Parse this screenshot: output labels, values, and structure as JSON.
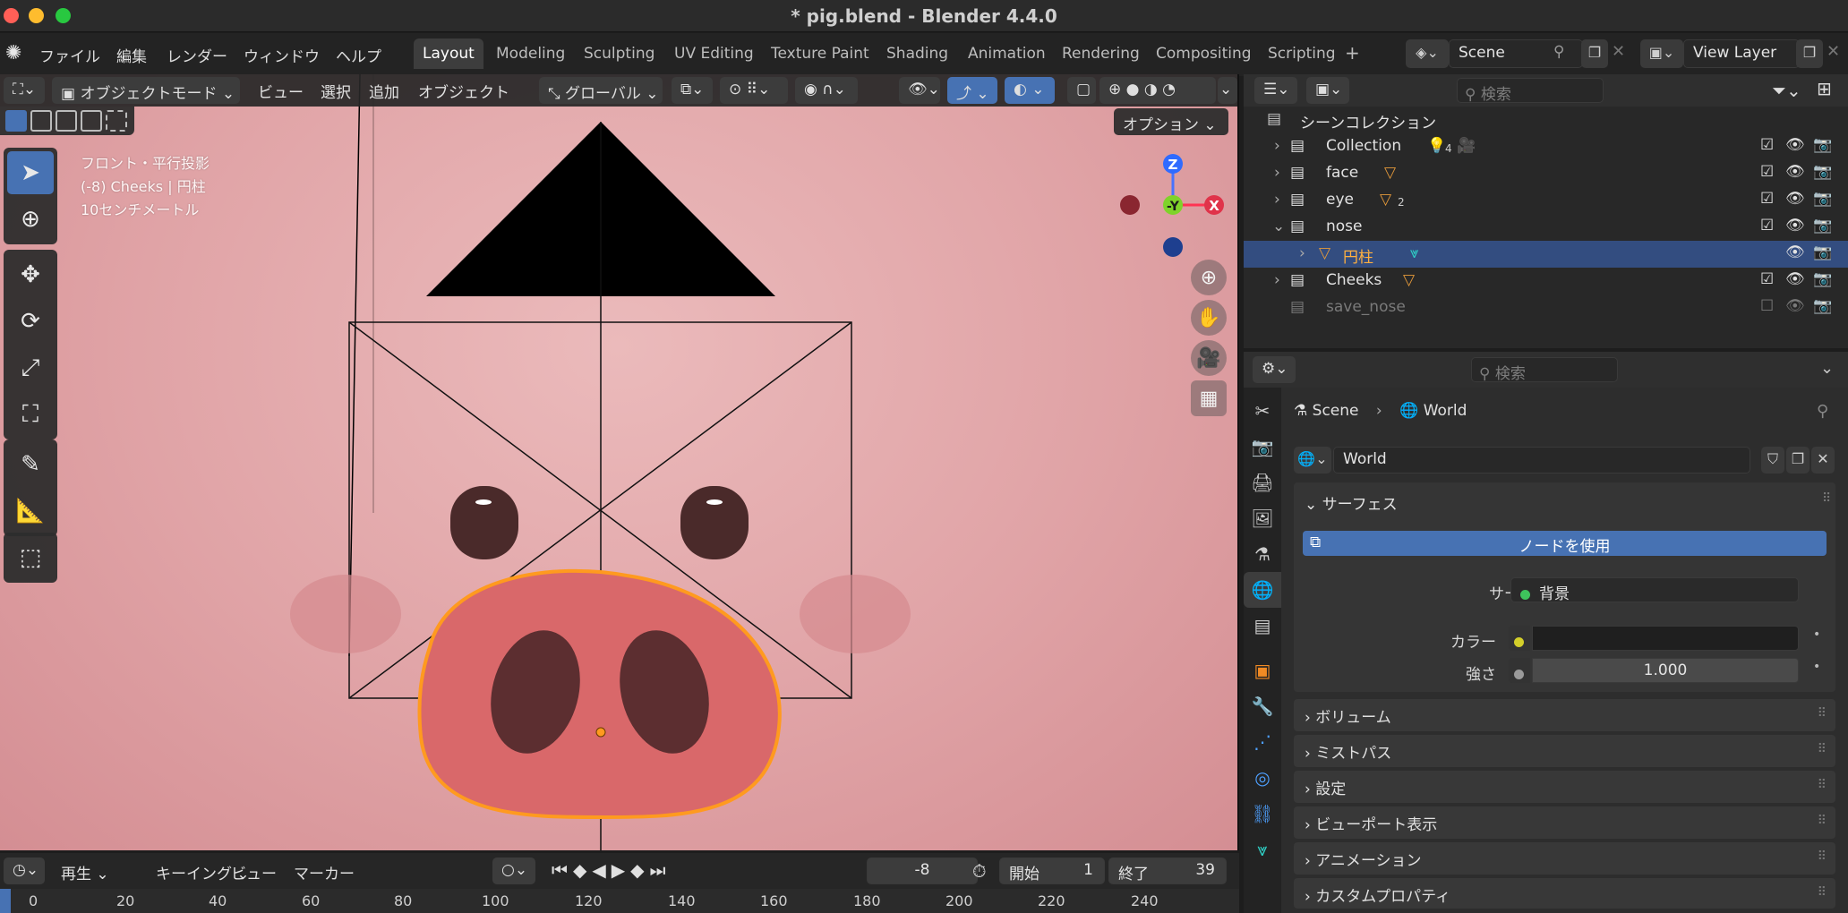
{
  "window": {
    "title": "* pig.blend - Blender 4.4.0",
    "traffic_colors": [
      "#ff5f57",
      "#febc2e",
      "#28c840"
    ]
  },
  "menubar": {
    "items": [
      "ファイル",
      "編集",
      "レンダー",
      "ウィンドウ",
      "ヘルプ"
    ],
    "workspaces": [
      "Layout",
      "Modeling",
      "Sculpting",
      "UV Editing",
      "Texture Paint",
      "Shading",
      "Animation",
      "Rendering",
      "Compositing",
      "Scripting"
    ],
    "active_workspace": "Layout",
    "add_tab": "+",
    "scene": "Scene",
    "view_layer": "View Layer"
  },
  "viewport": {
    "mode": "オブジェクトモード",
    "menus": [
      "ビュー",
      "選択",
      "追加",
      "オブジェクト"
    ],
    "transform": "グローバル",
    "options": "オプション",
    "info": [
      "フロント・平行投影",
      "(-8) Cheeks | 円柱",
      "10センチメートル"
    ],
    "gizmo": {
      "z": "Z",
      "y": "-Y",
      "x": "X"
    },
    "colors": {
      "bg": "#e3a6a9",
      "nose": "#d9686a",
      "nose_outline": "#ff9a1f",
      "eyes": "#4a2a2a",
      "cheek": "#d98a8e"
    }
  },
  "timeline": {
    "menus": [
      "再生",
      "キーイング",
      "ビュー",
      "マーカー"
    ],
    "current_frame": "-8",
    "start_label": "開始",
    "start": "1",
    "end_label": "終了",
    "end": "39",
    "ticks": [
      "0",
      "20",
      "40",
      "60",
      "80",
      "100",
      "120",
      "140",
      "160",
      "180",
      "200",
      "220",
      "240"
    ]
  },
  "outliner": {
    "search_placeholder": "検索",
    "root": "シーンコレクション",
    "rows": [
      {
        "name": "Collection",
        "badge": "4"
      },
      {
        "name": "face",
        "badge": ""
      },
      {
        "name": "eye",
        "badge": "2"
      },
      {
        "name": "nose",
        "badge": ""
      },
      {
        "name": "円柱",
        "badge": ""
      },
      {
        "name": "Cheeks",
        "badge": ""
      },
      {
        "name": "save_nose",
        "badge": ""
      }
    ]
  },
  "properties": {
    "search_placeholder": "検索",
    "breadcrumb": [
      "Scene",
      "World"
    ],
    "world_name": "World",
    "surface_panel": "サーフェス",
    "use_nodes": "ノードを使用",
    "surface_label": "サーフェス",
    "surface_value": "背景",
    "color_label": "カラー",
    "strength_label": "強さ",
    "strength_value": "1.000",
    "collapsed_panels": [
      "ボリューム",
      "ミストパス",
      "設定",
      "ビューポート表示",
      "アニメーション",
      "カスタムプロパティ"
    ]
  }
}
